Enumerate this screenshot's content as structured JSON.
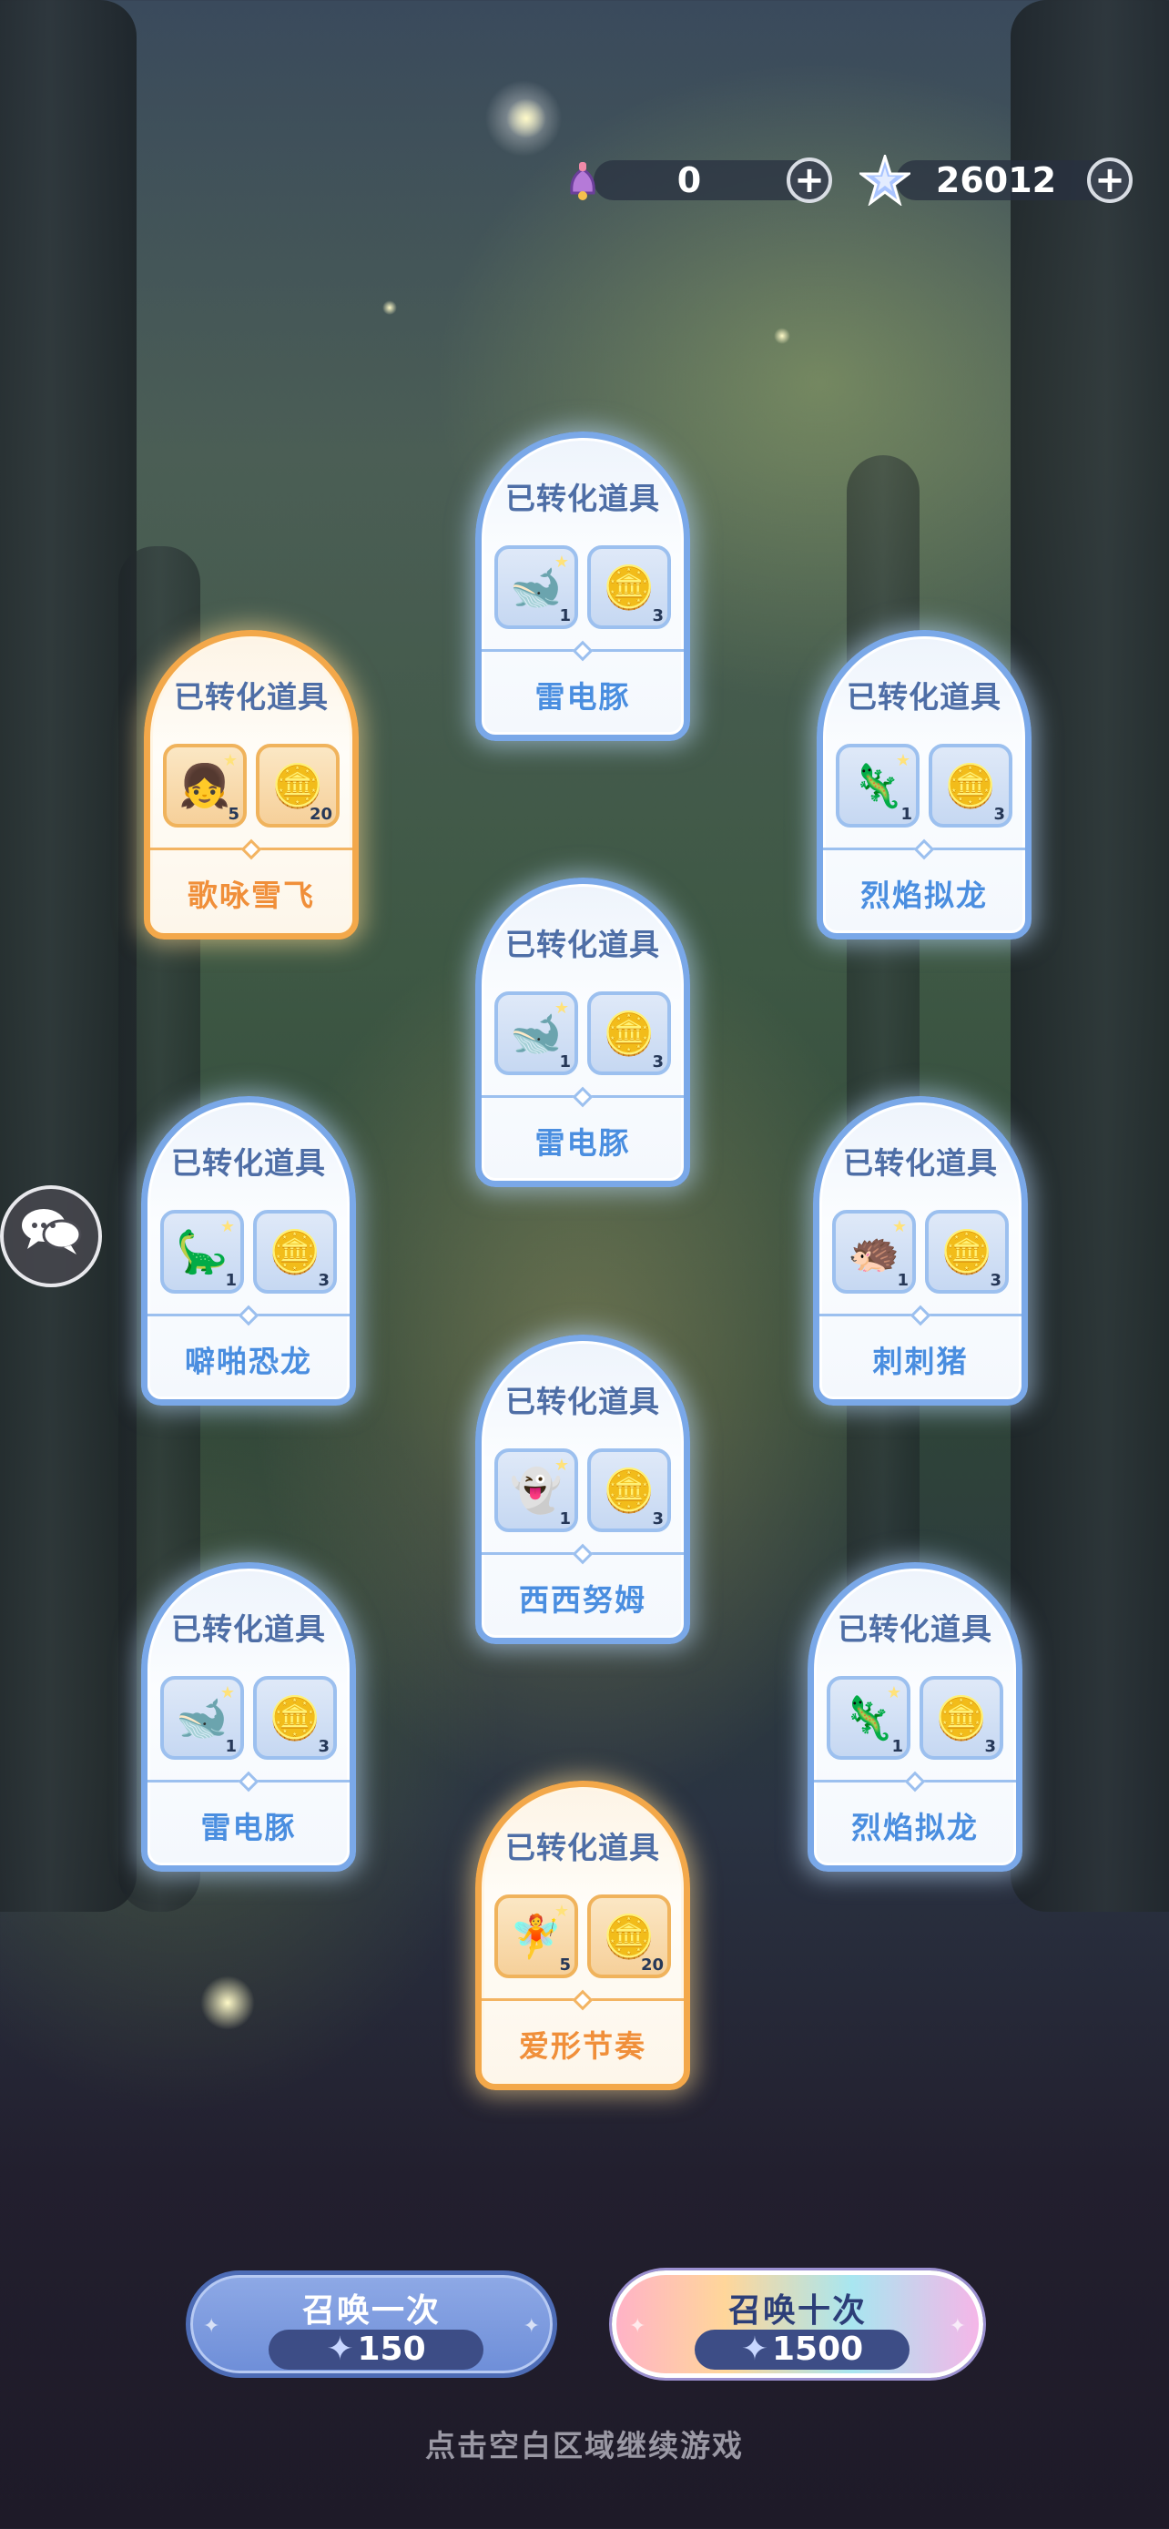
{
  "currency": {
    "tickets": {
      "icon": "bell-ticket-icon",
      "value": "0"
    },
    "stars": {
      "icon": "star-gem-icon",
      "value": "26012"
    }
  },
  "cards": [
    {
      "title": "已转化道具",
      "name": "雷电豚",
      "rarity": "blue",
      "items": [
        {
          "icon": "purple-whale-icon",
          "count": "1"
        },
        {
          "icon": "cat-coin-icon",
          "count": "3"
        }
      ]
    },
    {
      "title": "已转化道具",
      "name": "歌咏雪飞",
      "rarity": "gold",
      "items": [
        {
          "icon": "pink-girl-icon",
          "count": "5"
        },
        {
          "icon": "cat-coin-icon",
          "count": "20"
        }
      ]
    },
    {
      "title": "已转化道具",
      "name": "烈焰拟龙",
      "rarity": "blue",
      "items": [
        {
          "icon": "fire-dragon-icon",
          "count": "1"
        },
        {
          "icon": "cat-coin-icon",
          "count": "3"
        }
      ]
    },
    {
      "title": "已转化道具",
      "name": "雷电豚",
      "rarity": "blue",
      "items": [
        {
          "icon": "purple-whale-icon",
          "count": "1"
        },
        {
          "icon": "cat-coin-icon",
          "count": "3"
        }
      ]
    },
    {
      "title": "已转化道具",
      "name": "噼啪恐龙",
      "rarity": "blue",
      "items": [
        {
          "icon": "pink-dino-icon",
          "count": "1"
        },
        {
          "icon": "cat-coin-icon",
          "count": "3"
        }
      ]
    },
    {
      "title": "已转化道具",
      "name": "刺刺猪",
      "rarity": "blue",
      "items": [
        {
          "icon": "hedgehog-icon",
          "count": "1"
        },
        {
          "icon": "cat-coin-icon",
          "count": "3"
        }
      ]
    },
    {
      "title": "已转化道具",
      "name": "西西努姆",
      "rarity": "blue",
      "items": [
        {
          "icon": "white-spirit-icon",
          "count": "1"
        },
        {
          "icon": "cat-coin-icon",
          "count": "3"
        }
      ]
    },
    {
      "title": "已转化道具",
      "name": "雷电豚",
      "rarity": "blue",
      "items": [
        {
          "icon": "purple-whale-icon",
          "count": "1"
        },
        {
          "icon": "cat-coin-icon",
          "count": "3"
        }
      ]
    },
    {
      "title": "已转化道具",
      "name": "烈焰拟龙",
      "rarity": "blue",
      "items": [
        {
          "icon": "fire-dragon-icon",
          "count": "1"
        },
        {
          "icon": "cat-coin-icon",
          "count": "3"
        }
      ]
    },
    {
      "title": "已转化道具",
      "name": "爱形节奏",
      "rarity": "gold",
      "items": [
        {
          "icon": "purple-girl-icon",
          "count": "5"
        },
        {
          "icon": "cat-coin-icon",
          "count": "20"
        }
      ]
    }
  ],
  "summon": {
    "one": {
      "label": "召唤一次",
      "cost": "150",
      "icon": "star-gem-icon"
    },
    "ten": {
      "label": "召唤十次",
      "cost": "1500",
      "icon": "star-gem-icon"
    }
  },
  "chat": {
    "icon": "chat-bubbles-icon"
  },
  "hint": "点击空白区域继续游戏"
}
